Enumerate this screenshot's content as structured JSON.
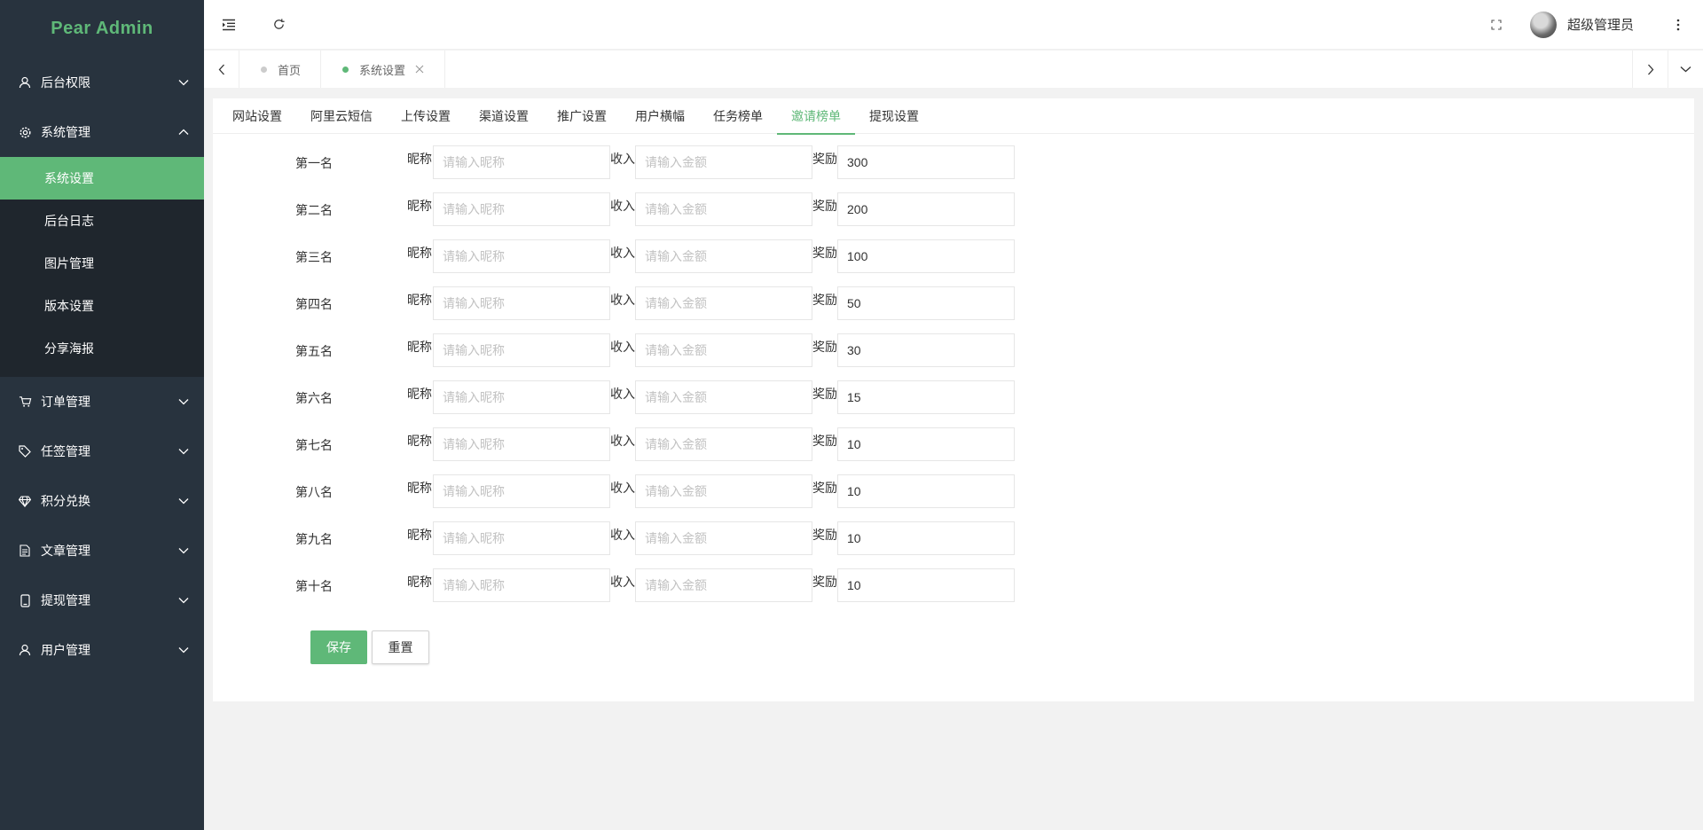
{
  "app": {
    "logo": "Pear Admin"
  },
  "sidebar": {
    "items": [
      {
        "label": "后台权限",
        "icon": "user-icon",
        "expanded": false
      },
      {
        "label": "系统管理",
        "icon": "gear-icon",
        "expanded": true,
        "children": [
          {
            "label": "系统设置",
            "active": true
          },
          {
            "label": "后台日志"
          },
          {
            "label": "图片管理"
          },
          {
            "label": "版本设置"
          },
          {
            "label": "分享海报"
          }
        ]
      },
      {
        "label": "订单管理",
        "icon": "cart-icon",
        "expanded": false
      },
      {
        "label": "任签管理",
        "icon": "tag-icon",
        "expanded": false
      },
      {
        "label": "积分兑换",
        "icon": "diamond-icon",
        "expanded": false
      },
      {
        "label": "文章管理",
        "icon": "document-icon",
        "expanded": false
      },
      {
        "label": "提现管理",
        "icon": "phone-icon",
        "expanded": false
      },
      {
        "label": "用户管理",
        "icon": "user-icon",
        "expanded": false
      }
    ]
  },
  "header": {
    "user_name": "超级管理员"
  },
  "page_tabs": [
    {
      "label": "首页",
      "active": false
    },
    {
      "label": "系统设置",
      "active": true
    }
  ],
  "settings_tabs": [
    {
      "label": "网站设置"
    },
    {
      "label": "阿里云短信"
    },
    {
      "label": "上传设置"
    },
    {
      "label": "渠道设置"
    },
    {
      "label": "推广设置"
    },
    {
      "label": "用户横幅"
    },
    {
      "label": "任务榜单"
    },
    {
      "label": "邀请榜单",
      "active": true
    },
    {
      "label": "提现设置"
    }
  ],
  "form": {
    "labels": {
      "nickname": "昵称",
      "income": "收入",
      "reward": "奖励"
    },
    "placeholders": {
      "nickname": "请输入昵称",
      "income": "请输入金额"
    },
    "rows": [
      {
        "rank": "第一名",
        "reward": "300"
      },
      {
        "rank": "第二名",
        "reward": "200"
      },
      {
        "rank": "第三名",
        "reward": "100"
      },
      {
        "rank": "第四名",
        "reward": "50"
      },
      {
        "rank": "第五名",
        "reward": "30"
      },
      {
        "rank": "第六名",
        "reward": "15"
      },
      {
        "rank": "第七名",
        "reward": "10"
      },
      {
        "rank": "第八名",
        "reward": "10"
      },
      {
        "rank": "第九名",
        "reward": "10"
      },
      {
        "rank": "第十名",
        "reward": "10"
      }
    ],
    "save_label": "保存",
    "reset_label": "重置"
  },
  "colors": {
    "accent": "#5fb878",
    "sidebar_bg": "#28333e",
    "submenu_bg": "#1f262d"
  }
}
